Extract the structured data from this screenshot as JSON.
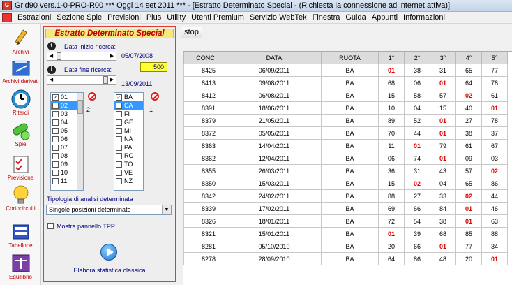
{
  "window": {
    "title": "Grid90 vers.1-0-PRO-R00  ***  Oggi 14 set 2011  ***  - [Estratto Determinato Special - (Richiesta la connessione ad internet attiva)]"
  },
  "menu": [
    "Estrazioni",
    "Sezione Spie",
    "Previsioni",
    "Plus",
    "Utility",
    "Utenti Premium",
    "Servizio WebTek",
    "Finestra",
    "Guida",
    "Appunti",
    "Informazioni"
  ],
  "toolbar": {
    "items": [
      {
        "label": "Archivi",
        "icon": "pencil-icon"
      },
      {
        "label": "Archivi derivati",
        "icon": "book-icon"
      },
      {
        "label": "Ritardi",
        "icon": "clock-icon"
      },
      {
        "label": "Spie",
        "icon": "pills-icon"
      },
      {
        "label": "Previsione",
        "icon": "checklist-icon"
      },
      {
        "label": "Cortocircuiti",
        "icon": "lightbulb-icon"
      },
      {
        "label": "Tabellone",
        "icon": "board-icon"
      },
      {
        "label": "Equilibrio",
        "icon": "scale-icon"
      }
    ]
  },
  "panel": {
    "title": "Estratto Determinato Special",
    "start_label": "Data inizio ricerca:",
    "start_date": "05/07/2008",
    "end_label": "Data fine ricerca:",
    "end_date": "13/09/2011",
    "end_value": "500",
    "numbers": [
      {
        "label": "01",
        "checked": true
      },
      {
        "label": "02",
        "checked": true,
        "selected": true
      },
      {
        "label": "03",
        "checked": false
      },
      {
        "label": "04",
        "checked": false
      },
      {
        "label": "05",
        "checked": false
      },
      {
        "label": "06",
        "checked": false
      },
      {
        "label": "07",
        "checked": false
      },
      {
        "label": "08",
        "checked": false
      },
      {
        "label": "09",
        "checked": false
      },
      {
        "label": "10",
        "checked": false
      },
      {
        "label": "11",
        "checked": false
      }
    ],
    "numbers_count": "2",
    "wheels": [
      {
        "label": "BA",
        "checked": true
      },
      {
        "label": "CA",
        "checked": false,
        "selected": true
      },
      {
        "label": "FI",
        "checked": false
      },
      {
        "label": "GE",
        "checked": false
      },
      {
        "label": "MI",
        "checked": false
      },
      {
        "label": "NA",
        "checked": false
      },
      {
        "label": "PA",
        "checked": false
      },
      {
        "label": "RO",
        "checked": false
      },
      {
        "label": "TO",
        "checked": false
      },
      {
        "label": "VE",
        "checked": false
      },
      {
        "label": "NZ",
        "checked": false
      }
    ],
    "wheels_count": "1",
    "analysis_label": "Tipologia di analisi determinata",
    "analysis_value": "Singole posizioni determinate",
    "tpp_label": "Mostra pannello TPP",
    "run_label": "Elabora statistica classica"
  },
  "stop_label": "stop",
  "grid": {
    "headers": [
      "CONC",
      "DATA",
      "RUOTA",
      "1°",
      "2°",
      "3°",
      "4°",
      "5°"
    ],
    "rows": [
      [
        "8425",
        "06/09/2011",
        "BA",
        "01",
        "38",
        "31",
        "65",
        "77"
      ],
      [
        "8413",
        "09/08/2011",
        "BA",
        "68",
        "06",
        "01",
        "64",
        "78"
      ],
      [
        "8412",
        "06/08/2011",
        "BA",
        "15",
        "58",
        "57",
        "02",
        "61"
      ],
      [
        "8391",
        "18/06/2011",
        "BA",
        "10",
        "04",
        "15",
        "40",
        "01"
      ],
      [
        "8379",
        "21/05/2011",
        "BA",
        "89",
        "52",
        "01",
        "27",
        "78"
      ],
      [
        "8372",
        "05/05/2011",
        "BA",
        "70",
        "44",
        "01",
        "38",
        "37"
      ],
      [
        "8363",
        "14/04/2011",
        "BA",
        "11",
        "01",
        "79",
        "61",
        "67"
      ],
      [
        "8362",
        "12/04/2011",
        "BA",
        "06",
        "74",
        "01",
        "09",
        "03"
      ],
      [
        "8355",
        "26/03/2011",
        "BA",
        "36",
        "31",
        "43",
        "57",
        "02"
      ],
      [
        "8350",
        "15/03/2011",
        "BA",
        "15",
        "02",
        "04",
        "65",
        "86"
      ],
      [
        "8342",
        "24/02/2011",
        "BA",
        "88",
        "27",
        "33",
        "02",
        "44"
      ],
      [
        "8339",
        "17/02/2011",
        "BA",
        "69",
        "66",
        "84",
        "01",
        "46"
      ],
      [
        "8326",
        "18/01/2011",
        "BA",
        "72",
        "54",
        "38",
        "01",
        "63"
      ],
      [
        "8321",
        "15/01/2011",
        "BA",
        "01",
        "39",
        "68",
        "85",
        "88"
      ],
      [
        "8281",
        "05/10/2010",
        "BA",
        "20",
        "66",
        "01",
        "77",
        "34"
      ],
      [
        "8278",
        "28/09/2010",
        "BA",
        "64",
        "86",
        "48",
        "20",
        "01"
      ]
    ],
    "highlight_values": [
      "01",
      "02"
    ]
  }
}
